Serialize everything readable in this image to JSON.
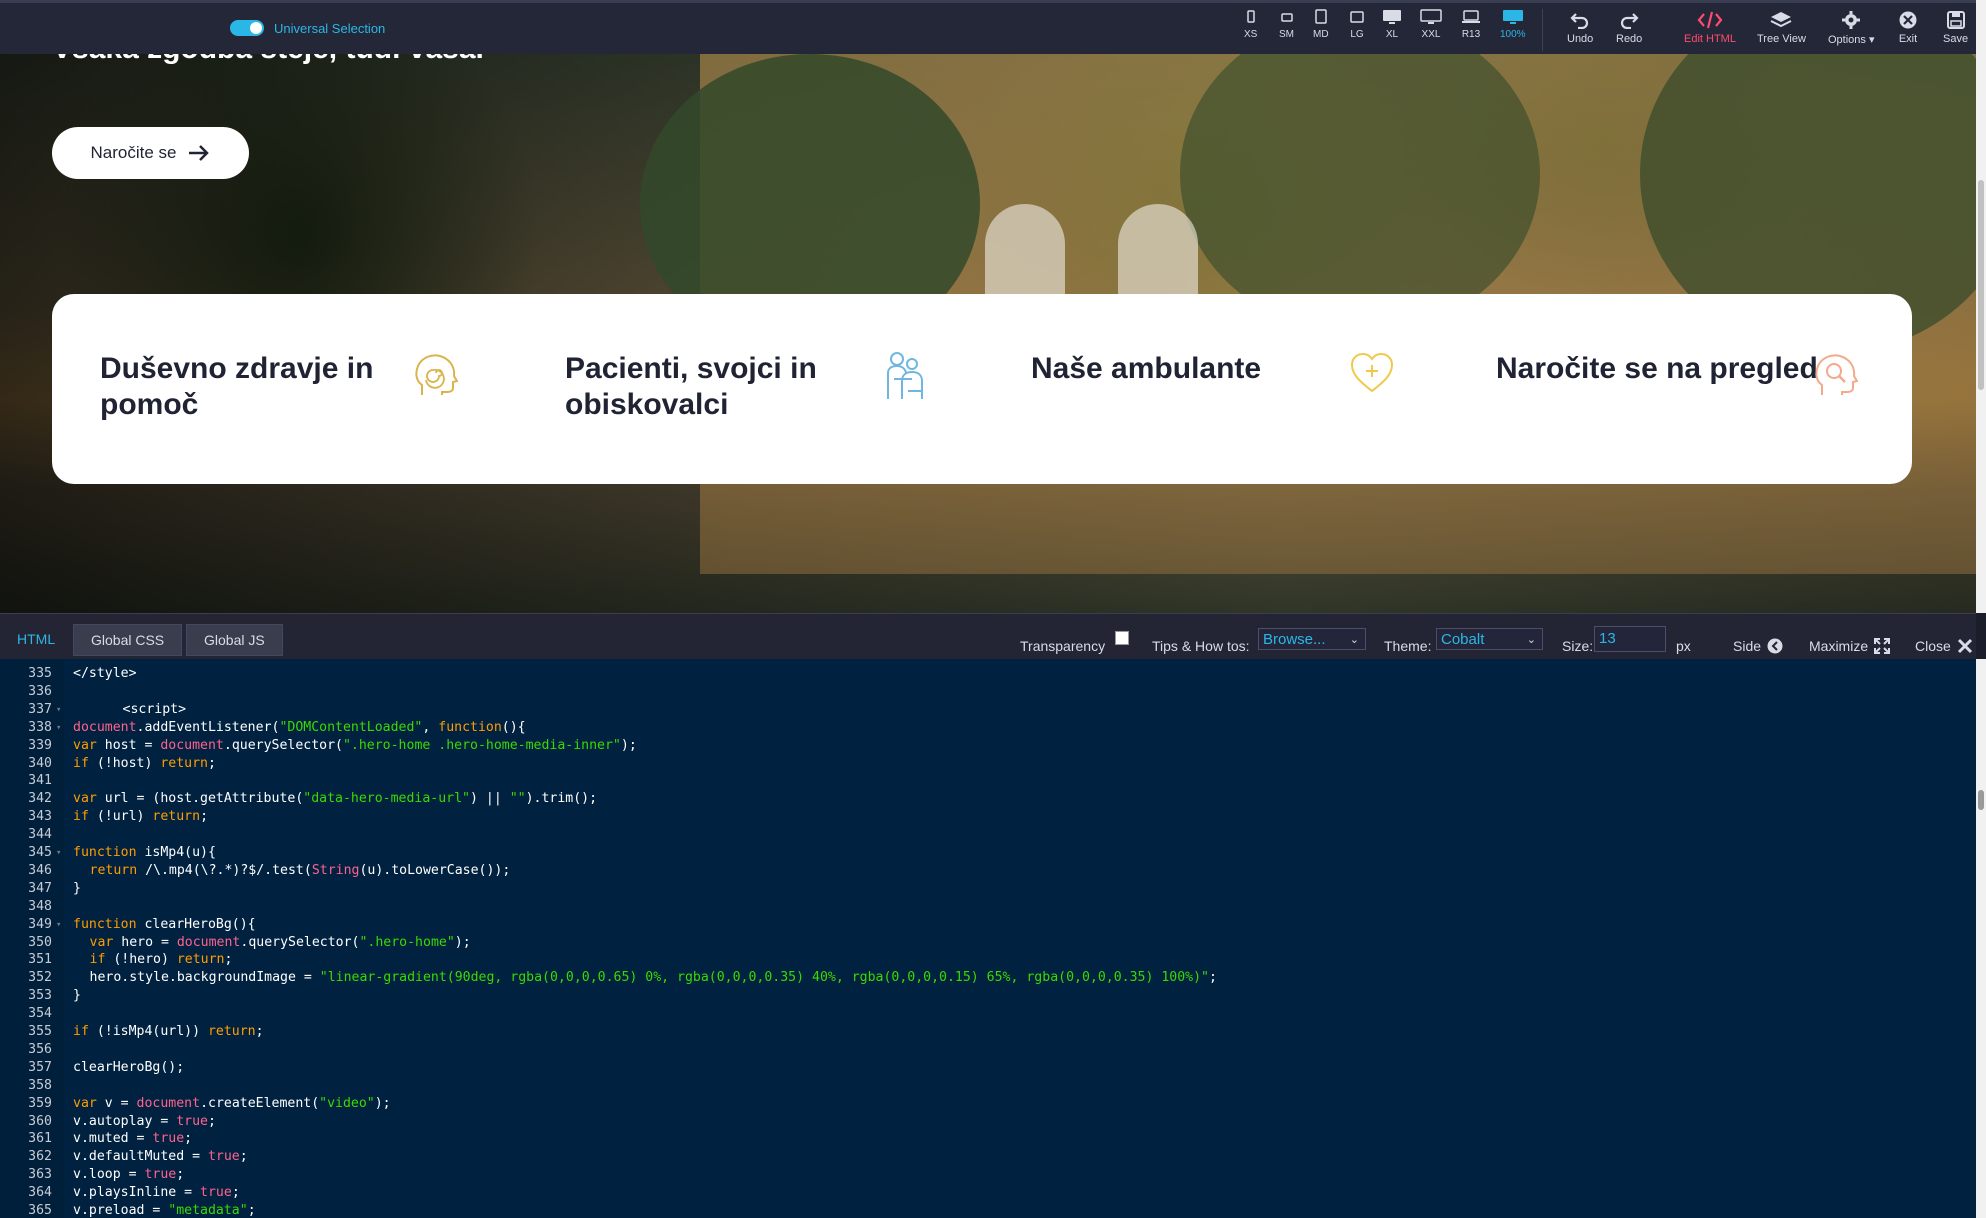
{
  "toolbar": {
    "universal_selection": "Universal Selection",
    "devices": [
      {
        "label": "XS",
        "icon": "phone-icon"
      },
      {
        "label": "SM",
        "icon": "phone-landscape-icon"
      },
      {
        "label": "MD",
        "icon": "tablet-icon"
      },
      {
        "label": "LG",
        "icon": "tablet-landscape-icon"
      },
      {
        "label": "XL",
        "icon": "monitor-icon"
      },
      {
        "label": "XXL",
        "icon": "monitor-wide-icon"
      },
      {
        "label": "R13",
        "icon": "laptop-icon"
      },
      {
        "label": "100%",
        "icon": "monitor-active-icon"
      }
    ],
    "undo": "Undo",
    "redo": "Redo",
    "edit_html": "Edit HTML",
    "tree_view": "Tree View",
    "options": "Options",
    "exit": "Exit",
    "save": "Save",
    "accent": "#2bb7e6",
    "edit_color": "#ff4b6e"
  },
  "hero": {
    "title": "Vsaka zgodba šteje, tudi vaša.",
    "cta": "Naročite se",
    "cards": [
      {
        "title": "Duševno zdravje in pomoč",
        "icon": "head-spiral-icon",
        "color": "#d9b44a"
      },
      {
        "title": "Pacienti, svojci in obiskovalci",
        "icon": "people-hug-icon",
        "color": "#6fb7e0"
      },
      {
        "title": "Naše ambulante",
        "icon": "heart-cross-icon",
        "color": "#f0c94a"
      },
      {
        "title": "Naročite se na pregled",
        "icon": "head-search-icon",
        "color": "#f3a98b"
      }
    ]
  },
  "editor": {
    "tabs": [
      "HTML",
      "Global CSS",
      "Global JS"
    ],
    "transparency": "Transparency",
    "tips": "Tips & How tos:",
    "tips_value": "Browse...",
    "theme": "Theme:",
    "theme_value": "Cobalt",
    "size": "Size:",
    "size_value": "13",
    "size_unit": "px",
    "side": "Side",
    "maximize": "Maximize",
    "close": "Close",
    "lines": [
      {
        "n": "335",
        "t": "</style>",
        "i": 1
      },
      {
        "n": "336",
        "t": "",
        "i": 0
      },
      {
        "n": "337",
        "t": "<script>",
        "i": 4,
        "fold": true
      },
      {
        "n": "338",
        "t": "document.addEventListener(\"DOMContentLoaded\", function(){",
        "i": 0,
        "fold": true
      },
      {
        "n": "339",
        "t": "var host = document.querySelector(\".hero-home .hero-home-media-inner\");",
        "i": 1
      },
      {
        "n": "340",
        "t": "if (!host) return;",
        "i": 1
      },
      {
        "n": "341",
        "t": "",
        "i": 0
      },
      {
        "n": "342",
        "t": "var url = (host.getAttribute(\"data-hero-media-url\") || \"\").trim();",
        "i": 1
      },
      {
        "n": "343",
        "t": "if (!url) return;",
        "i": 1
      },
      {
        "n": "344",
        "t": "",
        "i": 0
      },
      {
        "n": "345",
        "t": "function isMp4(u){",
        "i": 1,
        "fold": true
      },
      {
        "n": "346",
        "t": "return /\\.mp4(\\?.*)?$/.test(String(u).toLowerCase());",
        "i": 2
      },
      {
        "n": "347",
        "t": "}",
        "i": 1
      },
      {
        "n": "348",
        "t": "",
        "i": 0
      },
      {
        "n": "349",
        "t": "function clearHeroBg(){",
        "i": 1,
        "fold": true
      },
      {
        "n": "350",
        "t": "var hero = document.querySelector(\".hero-home\");",
        "i": 2
      },
      {
        "n": "351",
        "t": "if (!hero) return;",
        "i": 2
      },
      {
        "n": "352",
        "t": "hero.style.backgroundImage = \"linear-gradient(90deg, rgba(0,0,0,0.65) 0%, rgba(0,0,0,0.35) 40%, rgba(0,0,0,0.15) 65%, rgba(0,0,0,0.35) 100%)\";",
        "i": 2
      },
      {
        "n": "353",
        "t": "}",
        "i": 1
      },
      {
        "n": "354",
        "t": "",
        "i": 0
      },
      {
        "n": "355",
        "t": "if (!isMp4(url)) return;",
        "i": 1
      },
      {
        "n": "356",
        "t": "",
        "i": 0
      },
      {
        "n": "357",
        "t": "clearHeroBg();",
        "i": 1
      },
      {
        "n": "358",
        "t": "",
        "i": 0
      },
      {
        "n": "359",
        "t": "var v = document.createElement(\"video\");",
        "i": 1
      },
      {
        "n": "360",
        "t": "v.autoplay = true;",
        "i": 1
      },
      {
        "n": "361",
        "t": "v.muted = true;",
        "i": 1
      },
      {
        "n": "362",
        "t": "v.defaultMuted = true;",
        "i": 1
      },
      {
        "n": "363",
        "t": "v.loop = true;",
        "i": 1
      },
      {
        "n": "364",
        "t": "v.playsInline = true;",
        "i": 1
      },
      {
        "n": "365",
        "t": "v.preload = \"metadata\";",
        "i": 1
      }
    ]
  }
}
